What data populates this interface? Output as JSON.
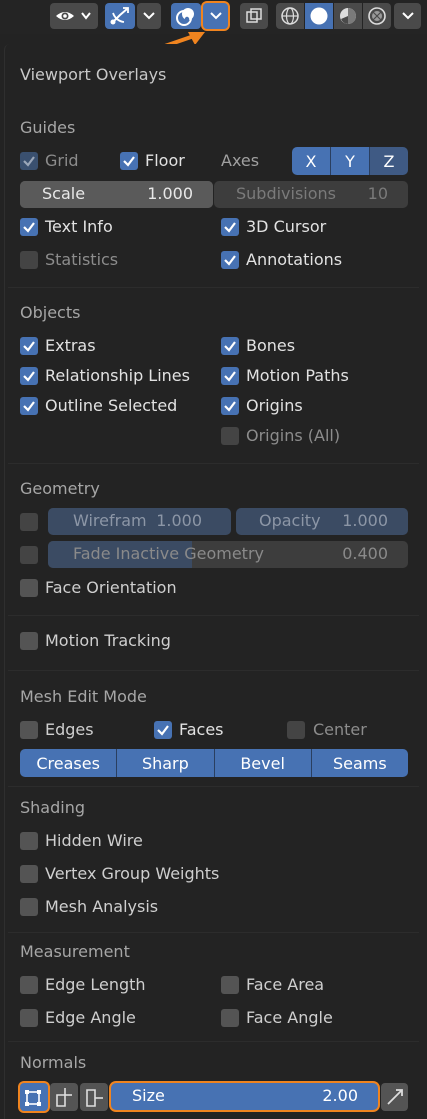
{
  "toolbar": {
    "items": [
      "view-dropdown",
      "gizmo-toggle",
      "gizmo-dropdown",
      "overlays-toggle",
      "overlays-dropdown",
      "xray-toggle",
      "shading-wireframe",
      "shading-solid",
      "shading-material",
      "shading-rendered",
      "shading-dropdown"
    ]
  },
  "panel": {
    "title": "Viewport Overlays",
    "guides": {
      "header": "Guides",
      "grid": "Grid",
      "floor": "Floor",
      "axes": "Axes",
      "axis_x": "X",
      "axis_y": "Y",
      "axis_z": "Z",
      "scale_label": "Scale",
      "scale_value": "1.000",
      "subdivisions_label": "Subdivisions",
      "subdivisions_value": "10",
      "text_info": "Text Info",
      "cursor_3d": "3D Cursor",
      "statistics": "Statistics",
      "annotations": "Annotations"
    },
    "objects": {
      "header": "Objects",
      "extras": "Extras",
      "bones": "Bones",
      "relationship_lines": "Relationship Lines",
      "motion_paths": "Motion Paths",
      "outline_selected": "Outline Selected",
      "origins": "Origins",
      "origins_all": "Origins (All)"
    },
    "geometry": {
      "header": "Geometry",
      "wireframe_label": "Wirefram",
      "wireframe_value": "1.000",
      "opacity_label": "Opacity",
      "opacity_value": "1.000",
      "fade_label": "Fade Inactive Geometry",
      "fade_value": "0.400",
      "fade_fraction": 0.4,
      "face_orientation": "Face Orientation"
    },
    "motion_tracking": "Motion Tracking",
    "mesh_edit": {
      "header": "Mesh Edit Mode",
      "edges": "Edges",
      "faces": "Faces",
      "center": "Center",
      "buttons": [
        "Creases",
        "Sharp",
        "Bevel",
        "Seams"
      ]
    },
    "shading": {
      "header": "Shading",
      "hidden_wire": "Hidden Wire",
      "vertex_group_weights": "Vertex Group Weights",
      "mesh_analysis": "Mesh Analysis"
    },
    "measurement": {
      "header": "Measurement",
      "edge_length": "Edge Length",
      "face_area": "Face Area",
      "edge_angle": "Edge Angle",
      "face_angle": "Face Angle"
    },
    "normals": {
      "header": "Normals",
      "size_label": "Size",
      "size_value": "2.00"
    }
  },
  "colors": {
    "accent": "#4772b3",
    "highlight": "#f0841f",
    "background": "#232323",
    "widget": "#545454"
  }
}
